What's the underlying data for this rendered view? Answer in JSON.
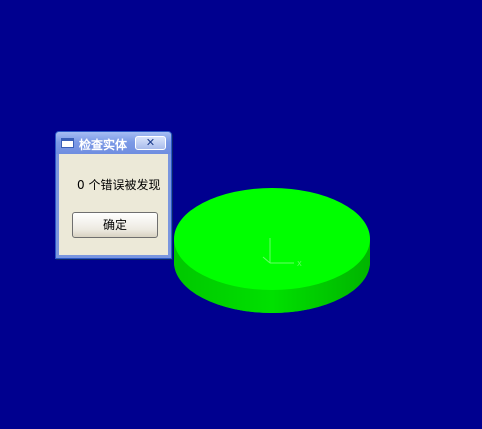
{
  "dialog": {
    "title": "检查实体",
    "close_label": "✕",
    "message": "0 个错误被发现",
    "ok_label": "确定"
  },
  "viewport": {
    "background_color": "#00008f",
    "model_color": "#00ff00",
    "axis_label": "X"
  }
}
